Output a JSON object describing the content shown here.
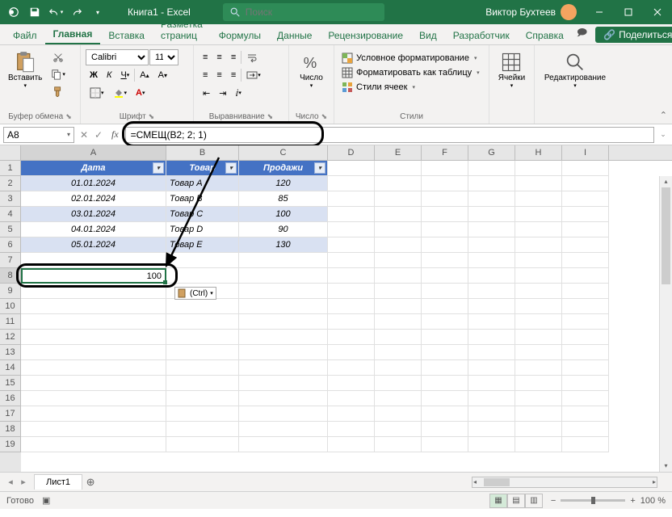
{
  "app": {
    "title": "Книга1 - Excel",
    "search_placeholder": "Поиск",
    "user_name": "Виктор Бухтеев"
  },
  "tabs": {
    "file": "Файл",
    "home": "Главная",
    "insert": "Вставка",
    "pagelayout": "Разметка страниц",
    "formulas": "Формулы",
    "data": "Данные",
    "review": "Рецензирование",
    "view": "Вид",
    "developer": "Разработчик",
    "help": "Справка",
    "comments": "☄",
    "share": "Поделиться"
  },
  "ribbon": {
    "paste": "Вставить",
    "clipboard": "Буфер обмена",
    "font_name": "Calibri",
    "font_size": "11",
    "font": "Шрифт",
    "alignment": "Выравнивание",
    "number_btn": "Число",
    "number": "Число",
    "cond_format": "Условное форматирование",
    "format_table": "Форматировать как таблицу",
    "cell_styles": "Стили ячеек",
    "styles": "Стили",
    "cells": "Ячейки",
    "editing": "Редактирование"
  },
  "formula": {
    "namebox": "A8",
    "content": "=СМЕЩ(B2; 2; 1)"
  },
  "table": {
    "headers": {
      "A": "Дата",
      "B": "Товар",
      "C": "Продажи"
    },
    "rows": [
      {
        "A": "01.01.2024",
        "B": "Товар A",
        "C": "120"
      },
      {
        "A": "02.01.2024",
        "B": "Товар B",
        "C": "85"
      },
      {
        "A": "03.01.2024",
        "B": "Товар C",
        "C": "100"
      },
      {
        "A": "04.01.2024",
        "B": "Товар D",
        "C": "90"
      },
      {
        "A": "05.01.2024",
        "B": "Товар E",
        "C": "130"
      }
    ]
  },
  "result_cell": "100",
  "paste_options": "(Ctrl)",
  "sheet": {
    "name": "Лист1"
  },
  "status": {
    "ready": "Готово",
    "zoom": "100 %"
  },
  "cols": [
    "A",
    "B",
    "C",
    "D",
    "E",
    "F",
    "G",
    "H",
    "I"
  ]
}
